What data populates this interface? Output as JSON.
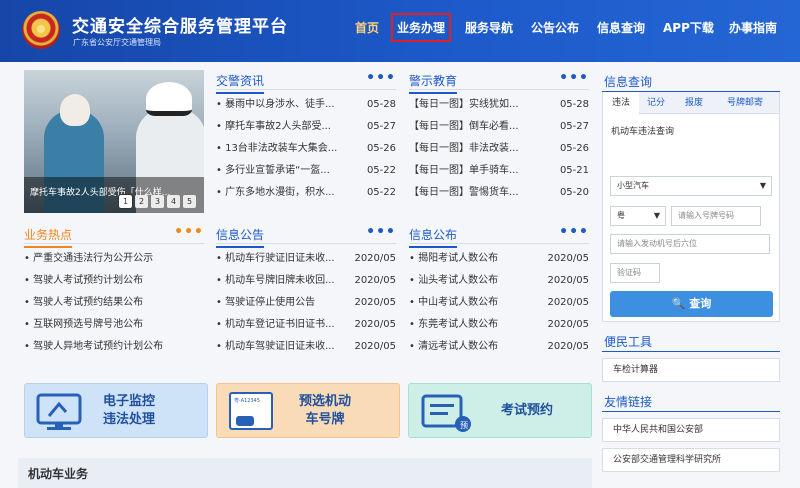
{
  "header": {
    "title": "交通安全综合服务管理平台",
    "subtitle": "广东省公安厅交通管理局",
    "nav": [
      "首页",
      "业务办理",
      "服务导航",
      "公告公布",
      "信息查询",
      "APP下载",
      "办事指南"
    ]
  },
  "slider": {
    "caption": "摩托车事故2人头部受伤「什么样...",
    "dots": [
      "1",
      "2",
      "3",
      "4",
      "5"
    ]
  },
  "news": {
    "title": "交警资讯",
    "more": "•••",
    "items": [
      {
        "text": "暴雨中以身涉水、徒手...",
        "date": "05-28"
      },
      {
        "text": "摩托车事故2人头部受...",
        "date": "05-27"
      },
      {
        "text": "13台非法改装车大集会...",
        "date": "05-26"
      },
      {
        "text": "多行业宣誓承诺“一盔...",
        "date": "05-22"
      },
      {
        "text": "广东多地水漫街，积水...",
        "date": "05-22"
      }
    ]
  },
  "warning": {
    "title": "警示教育",
    "more": "•••",
    "items": [
      {
        "text": "【每日一图】实线犹如...",
        "date": "05-28"
      },
      {
        "text": "【每日一图】倒车必看...",
        "date": "05-27"
      },
      {
        "text": "【每日一图】非法改装...",
        "date": "05-26"
      },
      {
        "text": "【每日一图】单手骑车...",
        "date": "05-21"
      },
      {
        "text": "【每日一图】警惕货车...",
        "date": "05-20"
      }
    ]
  },
  "hot": {
    "title": "业务热点",
    "more": "•••",
    "items": [
      "严重交通违法行为公开公示",
      "驾驶人考试预约计划公布",
      "驾驶人考试预约结果公布",
      "互联网预选号牌号池公布",
      "驾驶人异地考试预约计划公布"
    ]
  },
  "notice": {
    "title": "信息公告",
    "more": "•••",
    "items": [
      {
        "text": "机动车行驶证旧证未收...",
        "date": "2020/05"
      },
      {
        "text": "机动车号牌旧牌未收回...",
        "date": "2020/05"
      },
      {
        "text": "驾驶证停止使用公告",
        "date": "2020/05"
      },
      {
        "text": "机动车登记证书旧证书...",
        "date": "2020/05"
      },
      {
        "text": "机动车驾驶证旧证未收...",
        "date": "2020/05"
      }
    ]
  },
  "announce": {
    "title": "信息公布",
    "more": "•••",
    "items": [
      {
        "text": "揭阳考试人数公布",
        "date": "2020/05"
      },
      {
        "text": "汕头考试人数公布",
        "date": "2020/05"
      },
      {
        "text": "中山考试人数公布",
        "date": "2020/05"
      },
      {
        "text": "东莞考试人数公布",
        "date": "2020/05"
      },
      {
        "text": "清远考试人数公布",
        "date": "2020/05"
      }
    ]
  },
  "tiles": {
    "monitor": {
      "line1": "电子监控",
      "line2": "违法处理"
    },
    "plate": {
      "line1": "预选机动",
      "line2": "车号牌",
      "plate_text": "粤·A12345"
    },
    "exam": {
      "line1": "考试预约"
    }
  },
  "bottom": {
    "title": "机动车业务"
  },
  "query": {
    "title": "信息查询",
    "tabs": [
      "违法",
      "记分",
      "报废",
      "号牌邮寄"
    ],
    "subtitle": "机动车违法查询",
    "vehicle_type": "小型汽车",
    "province": "粤",
    "plate_placeholder": "请输入号牌号码",
    "engine_placeholder": "请输入发动机号后六位",
    "captcha_placeholder": "验证码",
    "submit": "查询"
  },
  "tools": {
    "title": "便民工具",
    "items": [
      "车检计算器"
    ]
  },
  "links": {
    "title": "友情链接",
    "items": [
      "中华人民共和国公安部",
      "公安部交通管理科学研究所"
    ]
  },
  "colors": {
    "brand": "#1d59c9",
    "accent": "#f0861c",
    "nav_highlight": "#e4201e"
  }
}
